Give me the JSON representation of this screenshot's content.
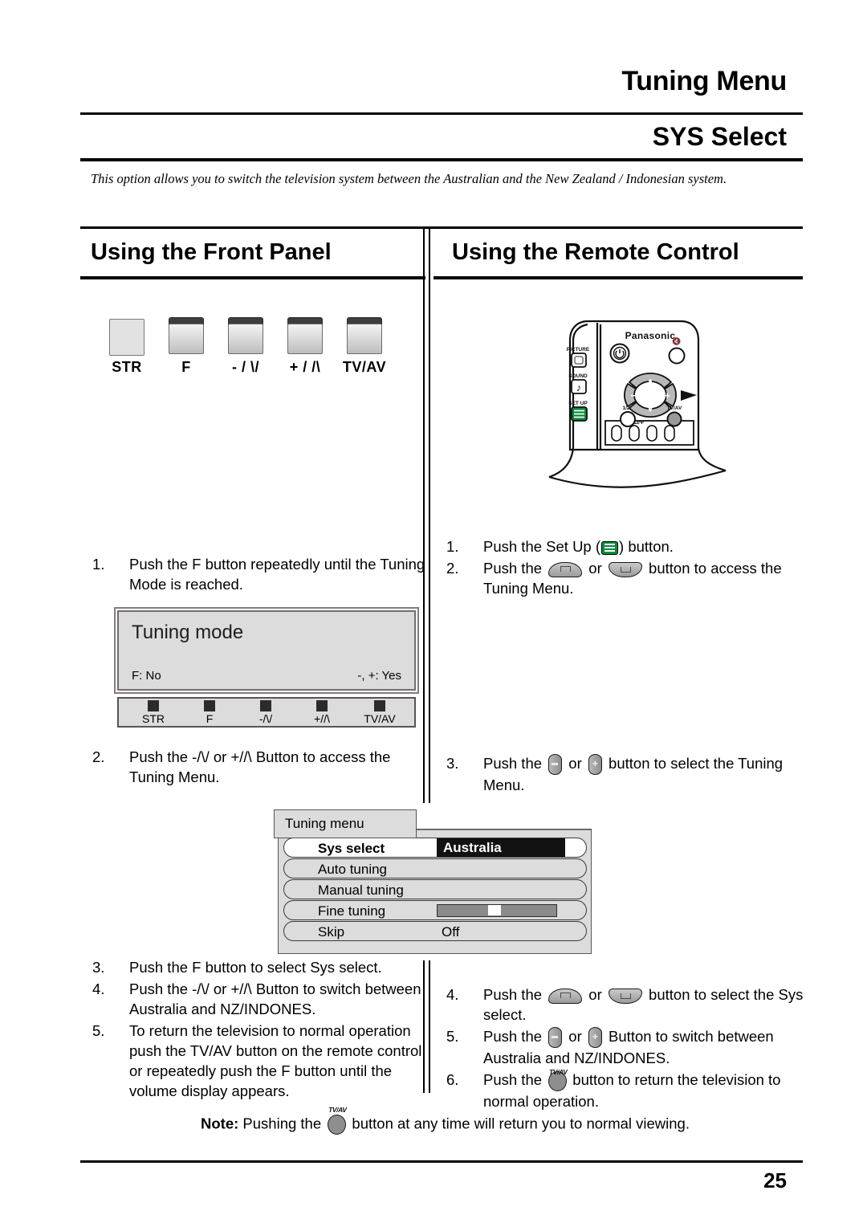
{
  "header": {
    "title": "Tuning Menu",
    "subtitle": "SYS Select",
    "intro": "This option allows you to switch the television system between the Australian and the New Zealand / Indonesian system."
  },
  "columns": {
    "left_heading": "Using the Front Panel",
    "right_heading": "Using the Remote Control"
  },
  "front_panel": {
    "buttons": [
      {
        "label": "STR",
        "style": "flat"
      },
      {
        "label": "F",
        "style": "raised"
      },
      {
        "label": "- / \\/",
        "style": "raised"
      },
      {
        "label": "+ / /\\",
        "style": "raised"
      },
      {
        "label": "TV/AV",
        "style": "raised"
      }
    ]
  },
  "remote": {
    "brand": "Panasonic",
    "labels": {
      "picture": "PICTURE",
      "sound": "SOUND",
      "setup": "SET UP",
      "power": "power-icon",
      "mute": "mute-icon",
      "tvav": "TV/AV",
      "half": "1/2",
      "nav_up": "∧",
      "nav_down": "∨",
      "nav_minus": "−",
      "nav_plus": "+"
    }
  },
  "left_steps_a": [
    {
      "num": "1.",
      "text": "Push the F button repeatedly until the Tuning Mode is reached."
    }
  ],
  "left_steps_b": [
    {
      "num": "2.",
      "text": "Push the -/\\/ or +//\\ Button to access the Tuning Menu."
    }
  ],
  "left_steps_c": [
    {
      "num": "3.",
      "text": "Push the F button to select Sys select."
    },
    {
      "num": "4.",
      "text": "Push the -/\\/ or +//\\ Button to switch between Australia and NZ/INDONES."
    },
    {
      "num": "5.",
      "text": "To return the television to normal operation push the TV/AV button on the remote control or repeatedly push the F button until the volume display appears."
    }
  ],
  "right_steps_a": [
    {
      "num": "1.",
      "pre": "Push the Set Up (",
      "icon": "setup-icon",
      "post": ") button."
    },
    {
      "num": "2.",
      "pre": "Push the ",
      "icon": "up-arrow-icon",
      "mid": " or ",
      "icon2": "down-arrow-icon",
      "post": " button to access the Tuning Menu."
    }
  ],
  "right_steps_b": [
    {
      "num": "3.",
      "pre": "Push the ",
      "icon": "minus-icon",
      "mid": " or ",
      "icon2": "plus-icon",
      "post": " button to select the Tuning Menu."
    }
  ],
  "right_steps_c": [
    {
      "num": "4.",
      "pre": "Push the ",
      "icon": "up-arrow-icon",
      "mid": " or ",
      "icon2": "down-arrow-icon",
      "post": " button to select the Sys select."
    },
    {
      "num": "5.",
      "pre": "Push the ",
      "icon": "minus-icon",
      "mid": " or ",
      "icon2": "plus-icon",
      "post": " Button to switch between Australia and NZ/INDONES."
    },
    {
      "num": "6.",
      "pre": "Push the ",
      "icon": "tvav-icon",
      "post": " button to return the television to normal operation."
    }
  ],
  "tv_screen": {
    "title": "Tuning mode",
    "bottom_left": "F: No",
    "bottom_right": "-, +: Yes",
    "button_bar": [
      "STR",
      "F",
      "-/\\/",
      "+//\\",
      "TV/AV"
    ]
  },
  "osd": {
    "tab_label": "Tuning menu",
    "rows": [
      {
        "label": "Sys select",
        "value": "Australia",
        "selected": true,
        "type": "highlight"
      },
      {
        "label": "Auto tuning",
        "value": "",
        "selected": false,
        "type": "plain"
      },
      {
        "label": "Manual tuning",
        "value": "",
        "selected": false,
        "type": "plain"
      },
      {
        "label": "Fine tuning",
        "value": "",
        "selected": false,
        "type": "slider"
      },
      {
        "label": "Skip",
        "value": "Off",
        "selected": false,
        "type": "plain"
      }
    ]
  },
  "note": {
    "bold": "Note:",
    "pre": " Pushing the ",
    "icon": "tvav-icon",
    "post": " button at any time will return you to normal viewing."
  },
  "footer": {
    "page_number": "25"
  },
  "colors": {
    "setup_green": "#0a8a3c",
    "osd_background": "#dcdcdc",
    "highlight": "#121212"
  }
}
